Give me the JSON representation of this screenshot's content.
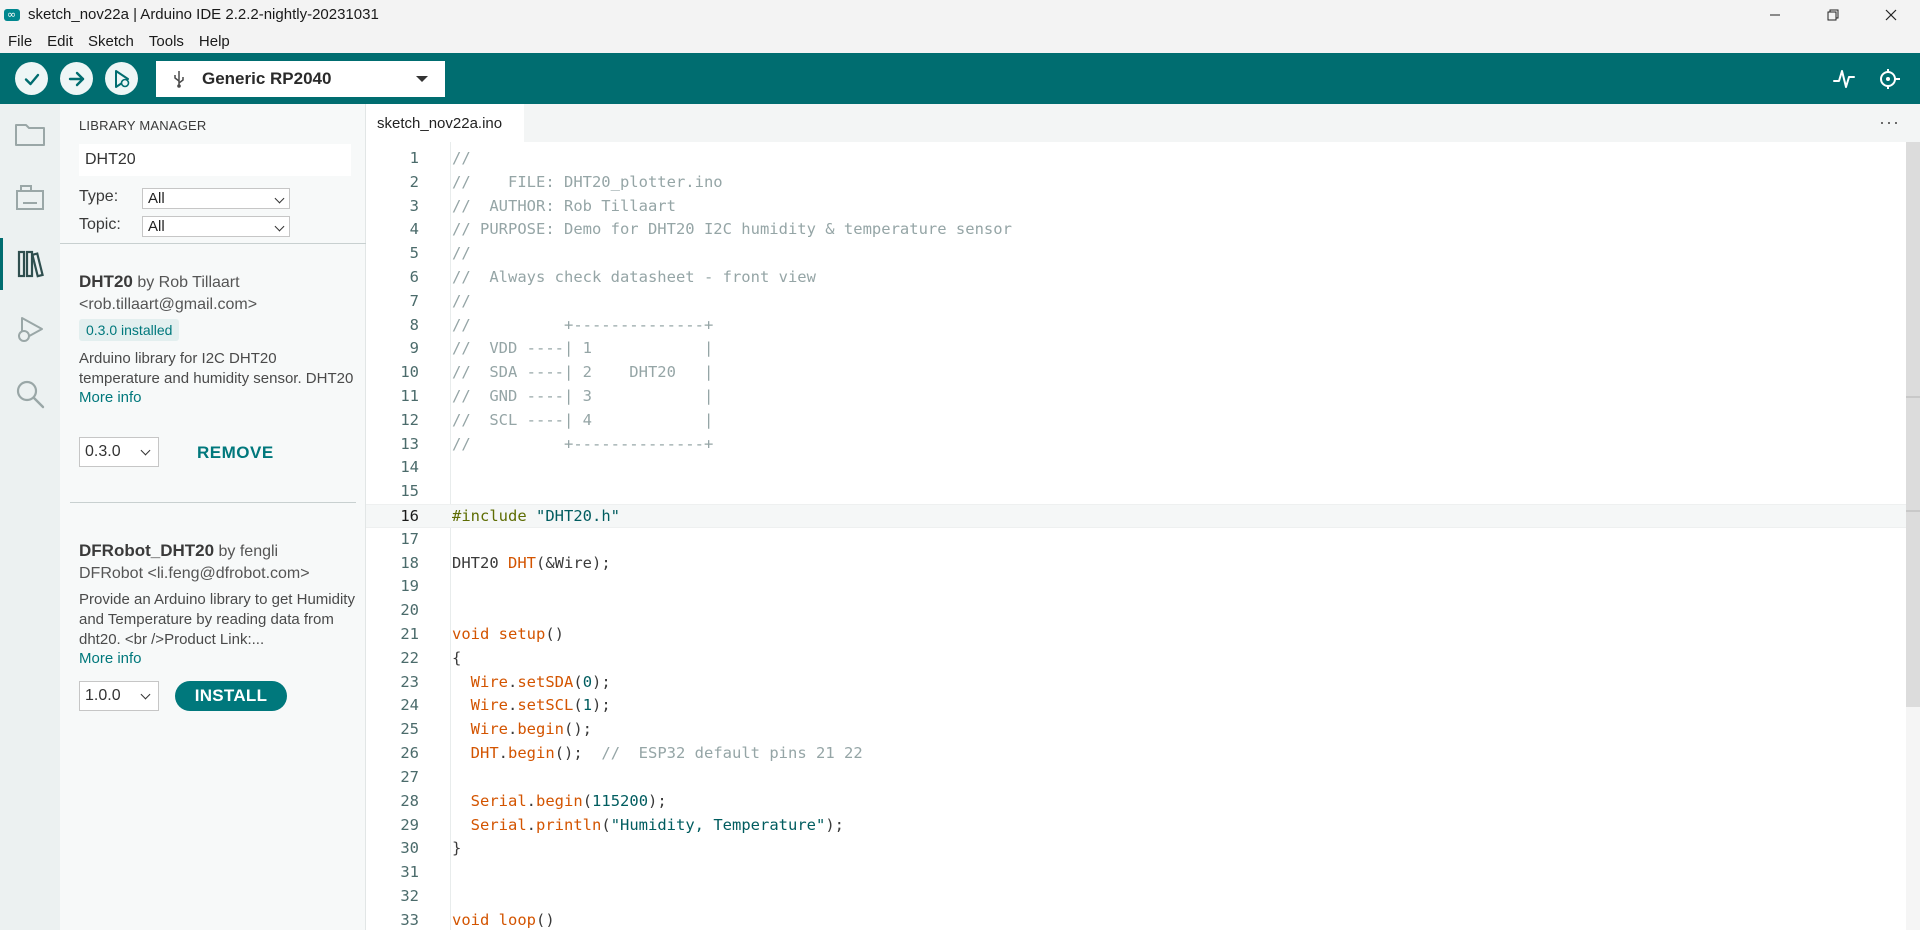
{
  "window": {
    "title": "sketch_nov22a | Arduino IDE 2.2.2-nightly-20231031",
    "controls": [
      "minimize",
      "restore",
      "close"
    ]
  },
  "menu": [
    "File",
    "Edit",
    "Sketch",
    "Tools",
    "Help"
  ],
  "toolbar": {
    "board": "Generic RP2040",
    "buttons": [
      "verify",
      "upload",
      "debug"
    ],
    "right_buttons": [
      "serial-plotter",
      "serial-monitor"
    ]
  },
  "activity_bar": [
    "sketchbook",
    "boards-manager",
    "library-manager",
    "debug",
    "search"
  ],
  "library_manager": {
    "title": "LIBRARY MANAGER",
    "search_value": "DHT20",
    "type_label": "Type:",
    "type_value": "All",
    "topic_label": "Topic:",
    "topic_value": "All",
    "libraries": [
      {
        "name": "DHT20",
        "by": "by Rob Tillaart",
        "email": "<rob.tillaart@gmail.com>",
        "badge": "0.3.0 installed",
        "description": "Arduino library for I2C DHT20 temperature and humidity sensor. DHT20",
        "more_info": "More info",
        "version": "0.3.0",
        "action": "REMOVE"
      },
      {
        "name": "DFRobot_DHT20",
        "by": "by fengli",
        "email": "DFRobot <li.feng@dfrobot.com>",
        "badge": "",
        "description": "Provide an Arduino library to get Humidity and Temperature by reading data from dht20. <br />Product Link:...",
        "more_info": "More info",
        "version": "1.0.0",
        "action": "INSTALL"
      }
    ]
  },
  "editor": {
    "tab": "sketch_nov22a.ino",
    "more": "···",
    "current_line": 16,
    "lines": [
      [
        [
          "c",
          "//"
        ]
      ],
      [
        [
          "c",
          "//    FILE: DHT20_plotter.ino"
        ]
      ],
      [
        [
          "c",
          "//  AUTHOR: Rob Tillaart"
        ]
      ],
      [
        [
          "c",
          "// PURPOSE: Demo for DHT20 I2C humidity & temperature sensor"
        ]
      ],
      [
        [
          "c",
          "//"
        ]
      ],
      [
        [
          "c",
          "//  Always check datasheet - front view"
        ]
      ],
      [
        [
          "c",
          "//"
        ]
      ],
      [
        [
          "c",
          "//          +--------------+"
        ]
      ],
      [
        [
          "c",
          "//  VDD ----| 1            |"
        ]
      ],
      [
        [
          "c",
          "//  SDA ----| 2    DHT20   |"
        ]
      ],
      [
        [
          "c",
          "//  GND ----| 3            |"
        ]
      ],
      [
        [
          "c",
          "//  SCL ----| 4            |"
        ]
      ],
      [
        [
          "c",
          "//          +--------------+"
        ]
      ],
      [],
      [],
      [
        [
          "p",
          "#include "
        ],
        [
          "s",
          "\"DHT20.h\""
        ]
      ],
      [],
      [
        [
          "t",
          "DHT20 "
        ],
        [
          "f",
          "DHT"
        ],
        [
          "t",
          "(&Wire);"
        ]
      ],
      [],
      [],
      [
        [
          "k",
          "void "
        ],
        [
          "f",
          "setup"
        ],
        [
          "t",
          "()"
        ]
      ],
      [
        [
          "t",
          "{"
        ]
      ],
      [
        [
          "t",
          "  "
        ],
        [
          "f",
          "Wire"
        ],
        [
          "t",
          "."
        ],
        [
          "f",
          "setSDA"
        ],
        [
          "t",
          "("
        ],
        [
          "n",
          "0"
        ],
        [
          "t",
          ");"
        ]
      ],
      [
        [
          "t",
          "  "
        ],
        [
          "f",
          "Wire"
        ],
        [
          "t",
          "."
        ],
        [
          "f",
          "setSCL"
        ],
        [
          "t",
          "("
        ],
        [
          "n",
          "1"
        ],
        [
          "t",
          ");"
        ]
      ],
      [
        [
          "t",
          "  "
        ],
        [
          "f",
          "Wire"
        ],
        [
          "t",
          "."
        ],
        [
          "f",
          "begin"
        ],
        [
          "t",
          "();"
        ]
      ],
      [
        [
          "t",
          "  "
        ],
        [
          "f",
          "DHT"
        ],
        [
          "t",
          "."
        ],
        [
          "f",
          "begin"
        ],
        [
          "t",
          "();  "
        ],
        [
          "c",
          "//  ESP32 default pins 21 22"
        ]
      ],
      [],
      [
        [
          "t",
          "  "
        ],
        [
          "f",
          "Serial"
        ],
        [
          "t",
          "."
        ],
        [
          "f",
          "begin"
        ],
        [
          "t",
          "("
        ],
        [
          "n",
          "115200"
        ],
        [
          "t",
          ");"
        ]
      ],
      [
        [
          "t",
          "  "
        ],
        [
          "f",
          "Serial"
        ],
        [
          "t",
          "."
        ],
        [
          "f",
          "println"
        ],
        [
          "t",
          "("
        ],
        [
          "s",
          "\"Humidity, Temperature\""
        ],
        [
          "t",
          ");"
        ]
      ],
      [
        [
          "t",
          "}"
        ]
      ],
      [],
      [],
      [
        [
          "k",
          "void "
        ],
        [
          "f",
          "loop"
        ],
        [
          "t",
          "()"
        ]
      ]
    ]
  }
}
